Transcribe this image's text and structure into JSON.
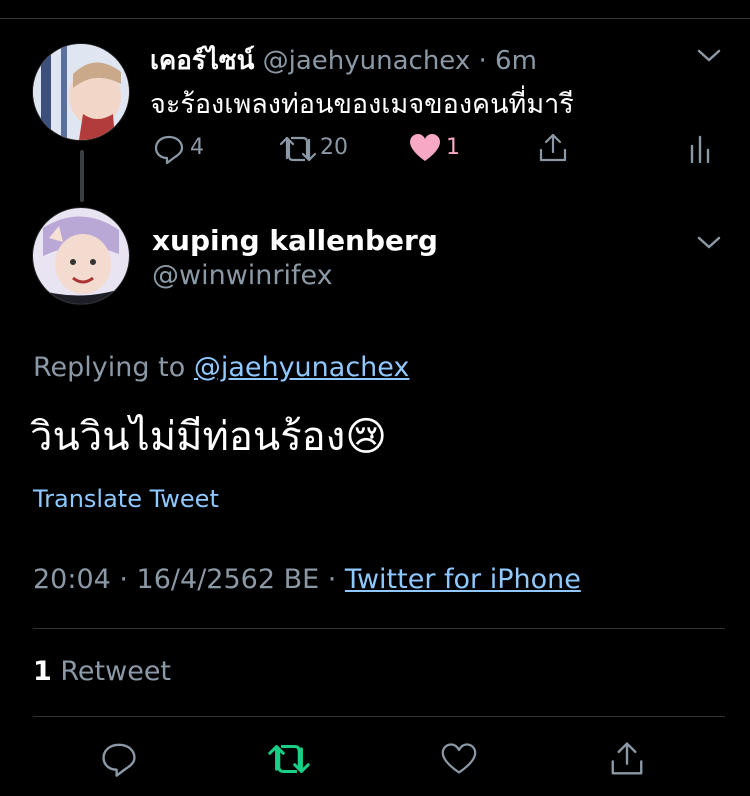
{
  "parent_tweet": {
    "display_name": "เคอร์ไซน์",
    "handle_time": "@jaehyunachex · 6m",
    "text": "จะร้องเพลงท่อนของเมจของคนที่มารี",
    "reply_count": "4",
    "retweet_count": "20",
    "like_count": "1"
  },
  "main_tweet": {
    "display_name": "xuping kallenberg",
    "handle": "@winwinrifex",
    "replying_prefix": "Replying to",
    "replying_handle": "@jaehyunachex",
    "text": "วินวินไม่มีท่อนร้อง",
    "emoji": "😢",
    "translate": "Translate Tweet",
    "timestamp": "20:04 · 16/4/2562 BE · ",
    "source": "Twitter for iPhone",
    "retweet_number": "1",
    "retweet_label": " Retweet"
  },
  "colors": {
    "background": "#000000",
    "muted": "#8b98a5",
    "link": "#8ec8ff",
    "like_pink": "#f7a8c4",
    "retweet_green": "#19cf86"
  }
}
